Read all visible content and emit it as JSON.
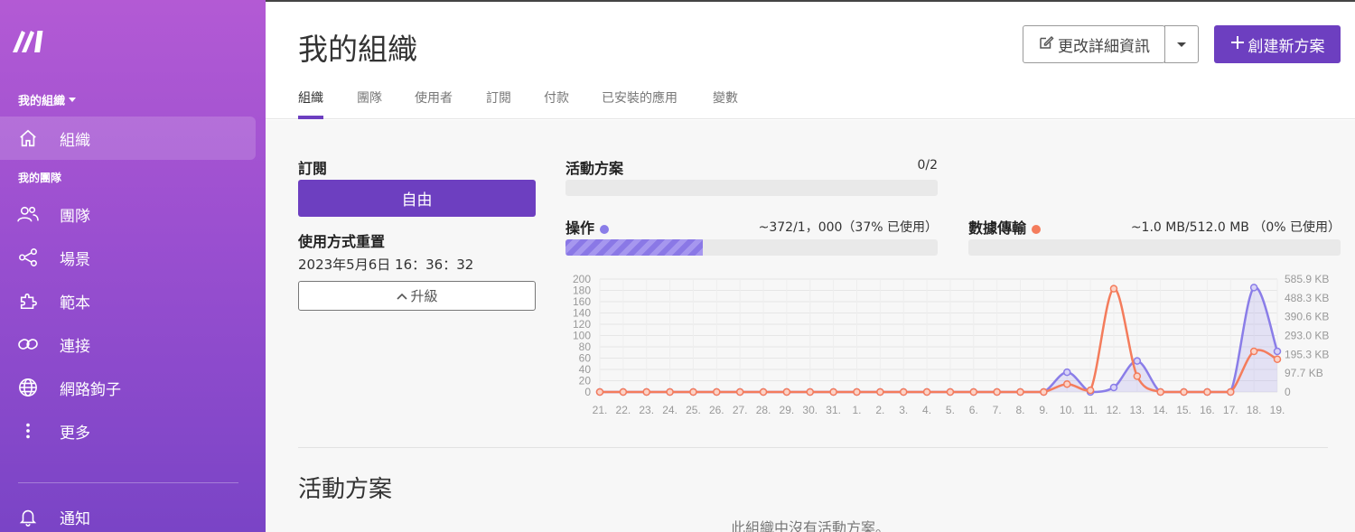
{
  "sidebar": {
    "org_switcher": "我的組織",
    "items_top": [
      {
        "label": "組織",
        "icon": "home-icon"
      }
    ],
    "team_section": "我的團隊",
    "items": [
      {
        "label": "團隊",
        "icon": "users-icon"
      },
      {
        "label": "場景",
        "icon": "share-icon"
      },
      {
        "label": "範本",
        "icon": "puzzle-icon"
      },
      {
        "label": "連接",
        "icon": "link-icon"
      },
      {
        "label": "網路鉤子",
        "icon": "globe-icon"
      },
      {
        "label": "更多",
        "icon": "more-vertical-icon"
      }
    ],
    "bottom": {
      "label": "通知",
      "icon": "bell-icon"
    }
  },
  "header": {
    "title": "我的組織",
    "edit_button": "更改詳細資訊",
    "create_button": "創建新方案",
    "tabs": [
      "組織",
      "團隊",
      "使用者",
      "訂閱",
      "付款",
      "已安裝的應用",
      "變數"
    ],
    "active_tab": 0
  },
  "subscription": {
    "label": "訂閱",
    "plan": "自由",
    "reset_label": "使用方式重置",
    "reset_time": "2023年5月6日 16：36：32",
    "upgrade_button": "升級"
  },
  "usage": {
    "active_scenarios": {
      "label": "活動方案",
      "value": "0/2",
      "fraction": 0
    },
    "operations": {
      "label": "操作",
      "value": "~372/1，000（37% 已使用）",
      "fraction": 0.37,
      "color": "#8a7de8"
    },
    "data_transfer": {
      "label": "數據傳輸",
      "value": "~1.0 MB/512.0 MB （0% 已使用）",
      "fraction": 0,
      "color": "#f47c5c"
    }
  },
  "chart_data": {
    "type": "line",
    "categories": [
      "21.",
      "22.",
      "23.",
      "24.",
      "25.",
      "26.",
      "27.",
      "28.",
      "29.",
      "30.",
      "31.",
      "1.",
      "2.",
      "3.",
      "4.",
      "5.",
      "6.",
      "7.",
      "8.",
      "9.",
      "10.",
      "11.",
      "12.",
      "13.",
      "14.",
      "15.",
      "16.",
      "17.",
      "18.",
      "19."
    ],
    "ylim": [
      0,
      200
    ],
    "yticks": [
      "0",
      "20",
      "40",
      "60",
      "80",
      "100",
      "120",
      "140",
      "160",
      "180",
      "200"
    ],
    "y2ticks": [
      "0",
      "97.7 KB",
      "195.3 KB",
      "293.0 KB",
      "390.6 KB",
      "488.3 KB",
      "585.9 KB"
    ],
    "series": [
      {
        "color": "#8a7de8",
        "values": [
          0,
          0,
          0,
          0,
          0,
          0,
          0,
          0,
          0,
          0,
          0,
          0,
          0,
          0,
          0,
          0,
          0,
          0,
          0,
          0,
          35,
          0,
          8,
          55,
          0,
          0,
          0,
          0,
          185,
          72
        ]
      },
      {
        "color": "#f47c5c",
        "values": [
          0,
          0,
          0,
          0,
          0,
          0,
          0,
          0,
          0,
          0,
          0,
          0,
          0,
          0,
          0,
          0,
          0,
          0,
          0,
          0,
          14,
          3,
          183,
          28,
          0,
          0,
          0,
          0,
          72,
          58
        ]
      }
    ],
    "grid": true
  },
  "main": {
    "section_title": "活動方案",
    "empty_message": "此組織中沒有活動方案。"
  }
}
